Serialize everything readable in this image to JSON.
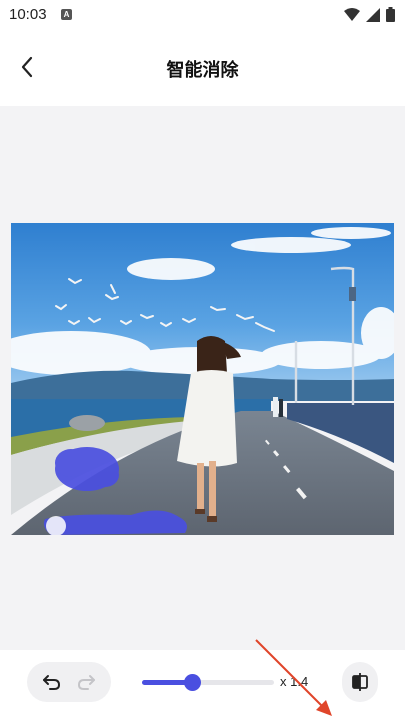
{
  "status_bar": {
    "time": "10:03",
    "notification_icon": "a-letter-icon",
    "icons": [
      "wifi-icon",
      "signal-icon",
      "battery-icon"
    ]
  },
  "header": {
    "title": "智能消除",
    "back_icon": "chevron-left-icon"
  },
  "canvas": {
    "background_color": "#f3f3f5",
    "image_description_icon": "photo-of-woman-walking-on-seaside-road",
    "brush_color": "#4a4fe0"
  },
  "toolbar": {
    "undo_icon": "undo-icon",
    "redo_icon": "redo-icon",
    "brush_size_fraction": 0.38,
    "brush_size_label": "x 1.4",
    "compare_icon": "compare-icon"
  },
  "colors": {
    "accent": "#4a4fe0",
    "annotation_arrow": "#e0452a"
  }
}
